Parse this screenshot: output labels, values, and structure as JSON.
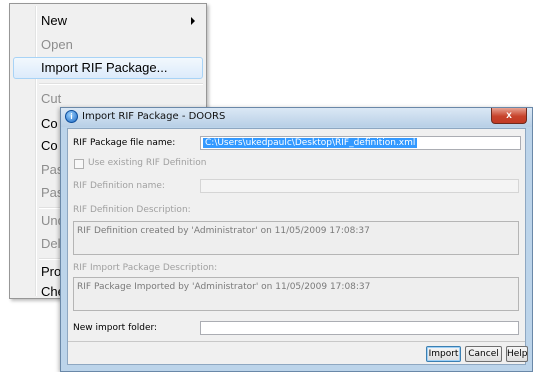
{
  "context_menu": {
    "items": [
      {
        "label": "New",
        "disabled": false,
        "submenu": true
      },
      {
        "label": "Open",
        "disabled": true
      },
      {
        "label": "Import RIF Package...",
        "disabled": false,
        "highlighted": true
      },
      {
        "label": "Cut",
        "disabled": true
      },
      {
        "label": "Co",
        "disabled": false
      },
      {
        "label": "Co",
        "disabled": false
      },
      {
        "label": "Pas",
        "disabled": true
      },
      {
        "label": "Pas",
        "disabled": true
      },
      {
        "label": "Und",
        "disabled": true
      },
      {
        "label": "Del",
        "disabled": true
      },
      {
        "label": "Pro",
        "disabled": false
      },
      {
        "label": "Che",
        "disabled": false
      }
    ]
  },
  "dialog": {
    "title": "Import RIF Package - DOORS",
    "close_label": "x",
    "file_name_label": "RIF Package file name:",
    "file_name_value": "C:\\Users\\ukedpaulc\\Desktop\\RIF_definition.xml",
    "use_existing_label": "Use existing RIF Definition",
    "definition_name_label": "RIF Definition name:",
    "definition_name_value": "",
    "definition_description_label": "RIF Definition Description:",
    "definition_description_value": "RIF Definition created by 'Administrator' on 11/05/2009 17:08:37",
    "import_description_label": "RIF Import Package Description:",
    "import_description_value": "RIF Package Imported by 'Administrator' on 11/05/2009 17:08:37",
    "import_folder_label": "New import folder:",
    "import_folder_value": "",
    "buttons": {
      "import": "Import",
      "cancel": "Cancel",
      "help": "Help"
    }
  }
}
